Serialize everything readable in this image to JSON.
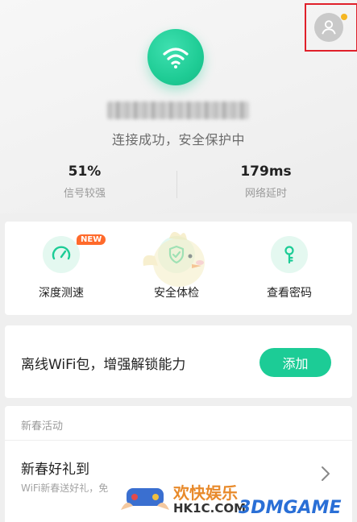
{
  "header": {
    "status_text": "连接成功，安全保护中",
    "signal": {
      "value": "51%",
      "label": "信号较强"
    },
    "latency": {
      "value": "179ms",
      "label": "网络延时"
    }
  },
  "tools": [
    {
      "label": "深度测速",
      "badge": "NEW",
      "icon": "speedometer-icon"
    },
    {
      "label": "安全体检",
      "icon": "shield-check-icon"
    },
    {
      "label": "查看密码",
      "icon": "key-icon"
    }
  ],
  "offline": {
    "text": "离线WiFi包，增强解锁能力",
    "button_label": "添加"
  },
  "events": {
    "section_title": "新春活动",
    "title": "新春好礼到",
    "subtitle": "WiFi新春送好礼，免"
  },
  "watermark": {
    "text": "欢快娱乐",
    "url": "HK1C.COM",
    "brand": "3DMGAME"
  },
  "colors": {
    "accent": "#1ccc96",
    "badge": "#ff6a2b",
    "highlight": "#e0202a",
    "notify_dot": "#f5b623"
  }
}
